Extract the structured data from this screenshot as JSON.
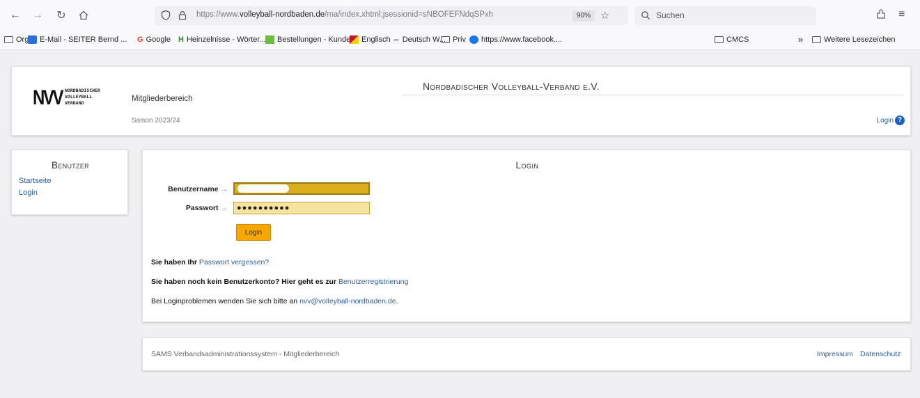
{
  "browser": {
    "url_prefix": "https://www.",
    "url_domain": "volleyball-nordbaden.de",
    "url_path": "/ma/index.xhtml;jsessionid=sNBOFEFNdqSPxh",
    "zoom": "90%",
    "search_placeholder": "Suchen",
    "bookmarks": [
      {
        "label": "Orga"
      },
      {
        "label": "E-Mail - SEITER Bernd ..."
      },
      {
        "label": "Google"
      },
      {
        "label": "Heinzelnisse - Wörter..."
      },
      {
        "label": "Bestellungen - Kunde..."
      },
      {
        "label": "Englisch ⇔ Deutsch W..."
      },
      {
        "label": "Priv"
      },
      {
        "label": "https://www.facebook...."
      },
      {
        "label": "CMCS"
      }
    ],
    "overflow_label": "»",
    "more_bookmarks": "Weitere Lesezeichen"
  },
  "header": {
    "logo_text_lines": [
      "NORDBADISCHER",
      "VOLLEYBALL",
      "VERBAND"
    ],
    "logo_mark": "NVV",
    "site_title": "Nordbadischer Volleyball-Verband e.V.",
    "area_label": "Mitgliederbereich",
    "season": "Saison 2023/24",
    "login_link": "Login",
    "help": "?"
  },
  "sidebar": {
    "title": "Benutzer",
    "items": [
      {
        "label": "Startseite"
      },
      {
        "label": "Login"
      }
    ]
  },
  "login": {
    "title": "Login",
    "username_label": "Benutzername",
    "password_label": "Passwort",
    "arrow": "→",
    "password_value": "●●●●●●●●●●",
    "button_label": "Login",
    "forgot_prefix": "Sie haben Ihr",
    "forgot_link": "Passwort vergessen?",
    "register_prefix": "Sie haben noch kein Benutzerkonto? Hier geht es zur",
    "register_link": "Benutzerregistrierung",
    "problem_prefix": "Bei Loginproblemen wenden Sie sich bitte an",
    "problem_email": "nvv@volleyball-nordbaden.de",
    "problem_suffix": "."
  },
  "footer": {
    "text": "SAMS Verbandsadministrationssystem - Mitgliederbereich",
    "impressum": "Impressum",
    "datenschutz": "Datenschutz"
  }
}
